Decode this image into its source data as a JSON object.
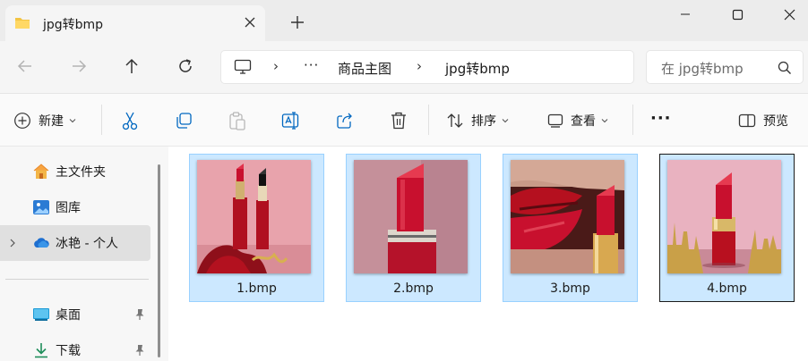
{
  "window": {
    "tab_title": "jpg转bmp",
    "tab_icon": "folder-icon",
    "controls": [
      "minimize-icon",
      "maximize-icon",
      "close-icon"
    ]
  },
  "navigation": {
    "buttons": [
      "back-arrow-icon",
      "forward-arrow-icon",
      "up-arrow-icon",
      "refresh-icon"
    ],
    "breadcrumb": {
      "root_icon": "this-pc-icon",
      "overflow": "···",
      "items": [
        "商品主图",
        "jpg转bmp"
      ]
    },
    "search_placeholder": "在 jpg转bmp"
  },
  "toolbar": {
    "new_label": "新建",
    "sort_label": "排序",
    "view_label": "查看",
    "more_label": "···",
    "preview_label": "预览",
    "icons": [
      "cut-icon",
      "copy-icon",
      "paste-icon",
      "rename-icon",
      "share-icon",
      "delete-icon"
    ]
  },
  "sidebar": {
    "items": [
      {
        "label": "主文件夹",
        "icon": "home-icon"
      },
      {
        "label": "图库",
        "icon": "gallery-icon"
      },
      {
        "label": "冰艳 - 个人",
        "icon": "cloud-icon",
        "selected": true
      },
      {
        "label": "桌面",
        "icon": "desktop-icon",
        "pinned": true
      },
      {
        "label": "下载",
        "icon": "download-icon",
        "pinned": true
      }
    ]
  },
  "files": [
    {
      "name": "1.bmp",
      "selected": true
    },
    {
      "name": "2.bmp",
      "selected": true
    },
    {
      "name": "3.bmp",
      "selected": true
    },
    {
      "name": "4.bmp",
      "selected": true,
      "focused": true
    }
  ],
  "colors": {
    "selection_fill": "#cce8ff",
    "selection_border": "#99d1ff",
    "accent_blue": "#0067c0",
    "lipstick_red": "#c8102e"
  }
}
